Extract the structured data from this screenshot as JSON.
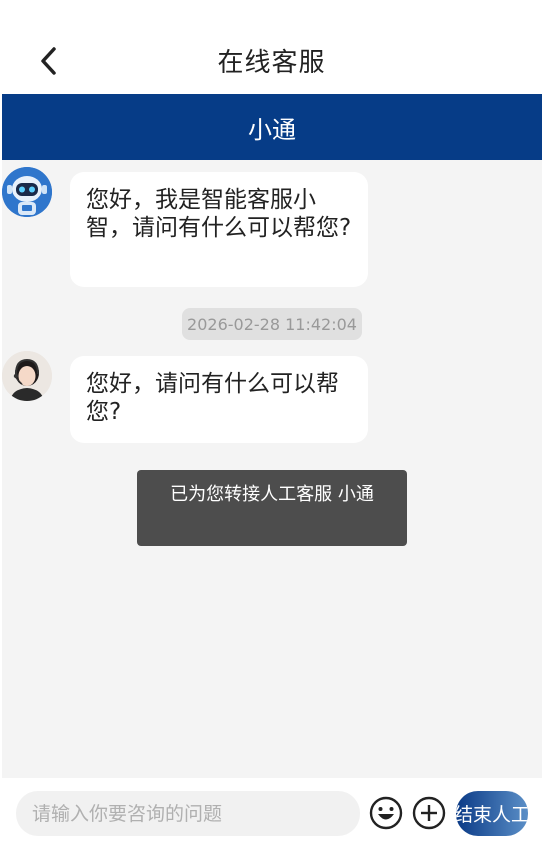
{
  "header": {
    "title": "在线客服",
    "back_icon": "chevron-left-icon"
  },
  "agent_bar": {
    "name": "小通",
    "color": "#063c87"
  },
  "messages": [
    {
      "sender": "bot",
      "avatar": "robot-avatar",
      "text": "您好，我是智能客服小智，请问有什么可以帮您?"
    },
    {
      "timestamp": "2026-02-28 11:42:04"
    },
    {
      "sender": "agent",
      "avatar": "agent-avatar",
      "text": "您好，请问有什么可以帮您?"
    }
  ],
  "toast": {
    "text": "已为您转接人工客服 小通"
  },
  "input_bar": {
    "placeholder": "请输入你要咨询的问题",
    "emoji_icon": "emoji-icon",
    "plus_icon": "plus-icon",
    "end_button_label": "结束人工"
  },
  "colors": {
    "brand": "#063c87",
    "chat_bg": "#f4f4f4",
    "toast_bg": "#4d4d4d"
  }
}
